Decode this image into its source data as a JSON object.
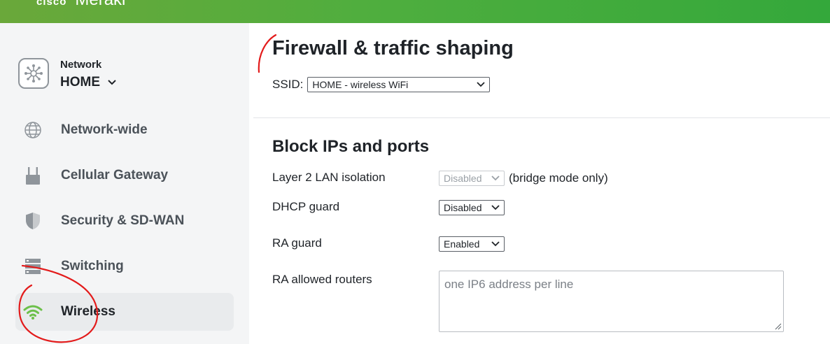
{
  "header": {
    "brand_prefix": "cisco",
    "brand_name": "Meraki"
  },
  "sidebar": {
    "network_label": "Network",
    "network_value": "HOME",
    "items": [
      {
        "label": "Network-wide",
        "icon": "globe-icon"
      },
      {
        "label": "Cellular Gateway",
        "icon": "gateway-icon"
      },
      {
        "label": "Security & SD-WAN",
        "icon": "shield-icon"
      },
      {
        "label": "Switching",
        "icon": "switch-icon"
      },
      {
        "label": "Wireless",
        "icon": "wifi-icon",
        "active": true
      }
    ]
  },
  "main": {
    "page_title": "Firewall & traffic shaping",
    "ssid_label": "SSID:",
    "ssid_value": "HOME - wireless WiFi",
    "section_title": "Block IPs and ports",
    "fields": {
      "layer2": {
        "label": "Layer 2 LAN isolation",
        "value": "Disabled",
        "note": "(bridge mode only)"
      },
      "dhcp": {
        "label": "DHCP guard",
        "value": "Disabled"
      },
      "ra_guard": {
        "label": "RA guard",
        "value": "Enabled"
      },
      "ra_routers": {
        "label": "RA allowed routers",
        "placeholder": "one IP6 address per line"
      }
    }
  },
  "colors": {
    "header_green": "#4fae3e",
    "sidebar_bg": "#f4f5f6",
    "wifi_green": "#6cc04a",
    "annotation_red": "#e31b1b"
  }
}
